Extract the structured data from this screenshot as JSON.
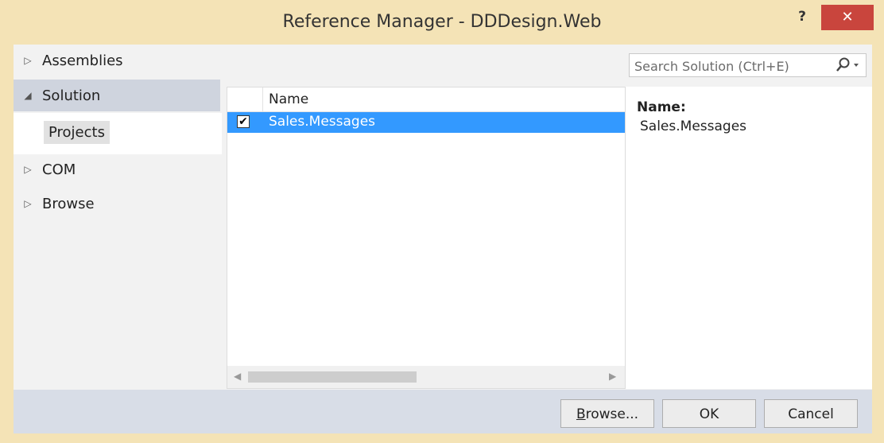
{
  "window": {
    "title": "Reference Manager - DDDesign.Web",
    "help_label": "?",
    "close_label": "✕"
  },
  "nav": {
    "items": [
      {
        "label": "Assemblies",
        "arrow": "▷"
      },
      {
        "label": "Solution",
        "arrow": "◢"
      },
      {
        "label": "COM",
        "arrow": "▷"
      },
      {
        "label": "Browse",
        "arrow": "▷"
      }
    ],
    "sub_item": "Projects"
  },
  "search": {
    "placeholder": "Search Solution (Ctrl+E)",
    "icon": "search-icon"
  },
  "grid": {
    "column_name": "Name",
    "rows": [
      {
        "name": "Sales.Messages",
        "checked": true
      }
    ]
  },
  "details": {
    "label": "Name:",
    "value": "Sales.Messages"
  },
  "footer": {
    "browse_label_ul": "B",
    "browse_label_rest": "rowse...",
    "ok_label": "OK",
    "cancel_label": "Cancel"
  },
  "colors": {
    "window_border": "#f4e3b6",
    "close_button": "#c9453d",
    "selection": "#3399ff"
  }
}
